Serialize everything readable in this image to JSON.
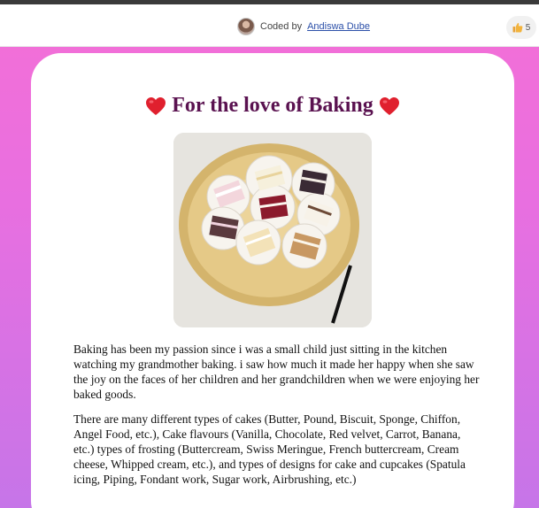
{
  "header": {
    "credit_prefix": "Coded by",
    "credit_author": "Andiswa Dube",
    "like_count": "5",
    "avatar_icon": "user-avatar-icon",
    "like_icon": "thumbs-up-icon"
  },
  "main": {
    "title": "For the love of Baking",
    "heart_icon": "heart-icon",
    "image_alt": "plate of assorted cake slices",
    "paragraphs": [
      "Baking has been my passion since i was a small child just sitting in the kitchen watching my grandmother baking. i saw how much it made her happy when she saw the joy on the faces of her children and her grandchildren when we were enjoying her baked goods.",
      "There are many different types of cakes (Butter, Pound, Biscuit, Sponge, Chiffon, Angel Food, etc.), Cake flavours (Vanilla, Chocolate, Red velvet, Carrot, Banana, etc.) types of frosting (Buttercream, Swiss Meringue, French buttercream, Cream cheese, Whipped cream, etc.), and types of designs for cake and cupcakes (Spatula icing, Piping, Fondant work, Sugar work, Airbrushing, etc.)"
    ]
  },
  "colors": {
    "background_top": "#f46fd6",
    "background_bottom": "#c675e8",
    "title": "#5a1250",
    "heart": "#e0202e",
    "link": "#2b4fa8"
  }
}
